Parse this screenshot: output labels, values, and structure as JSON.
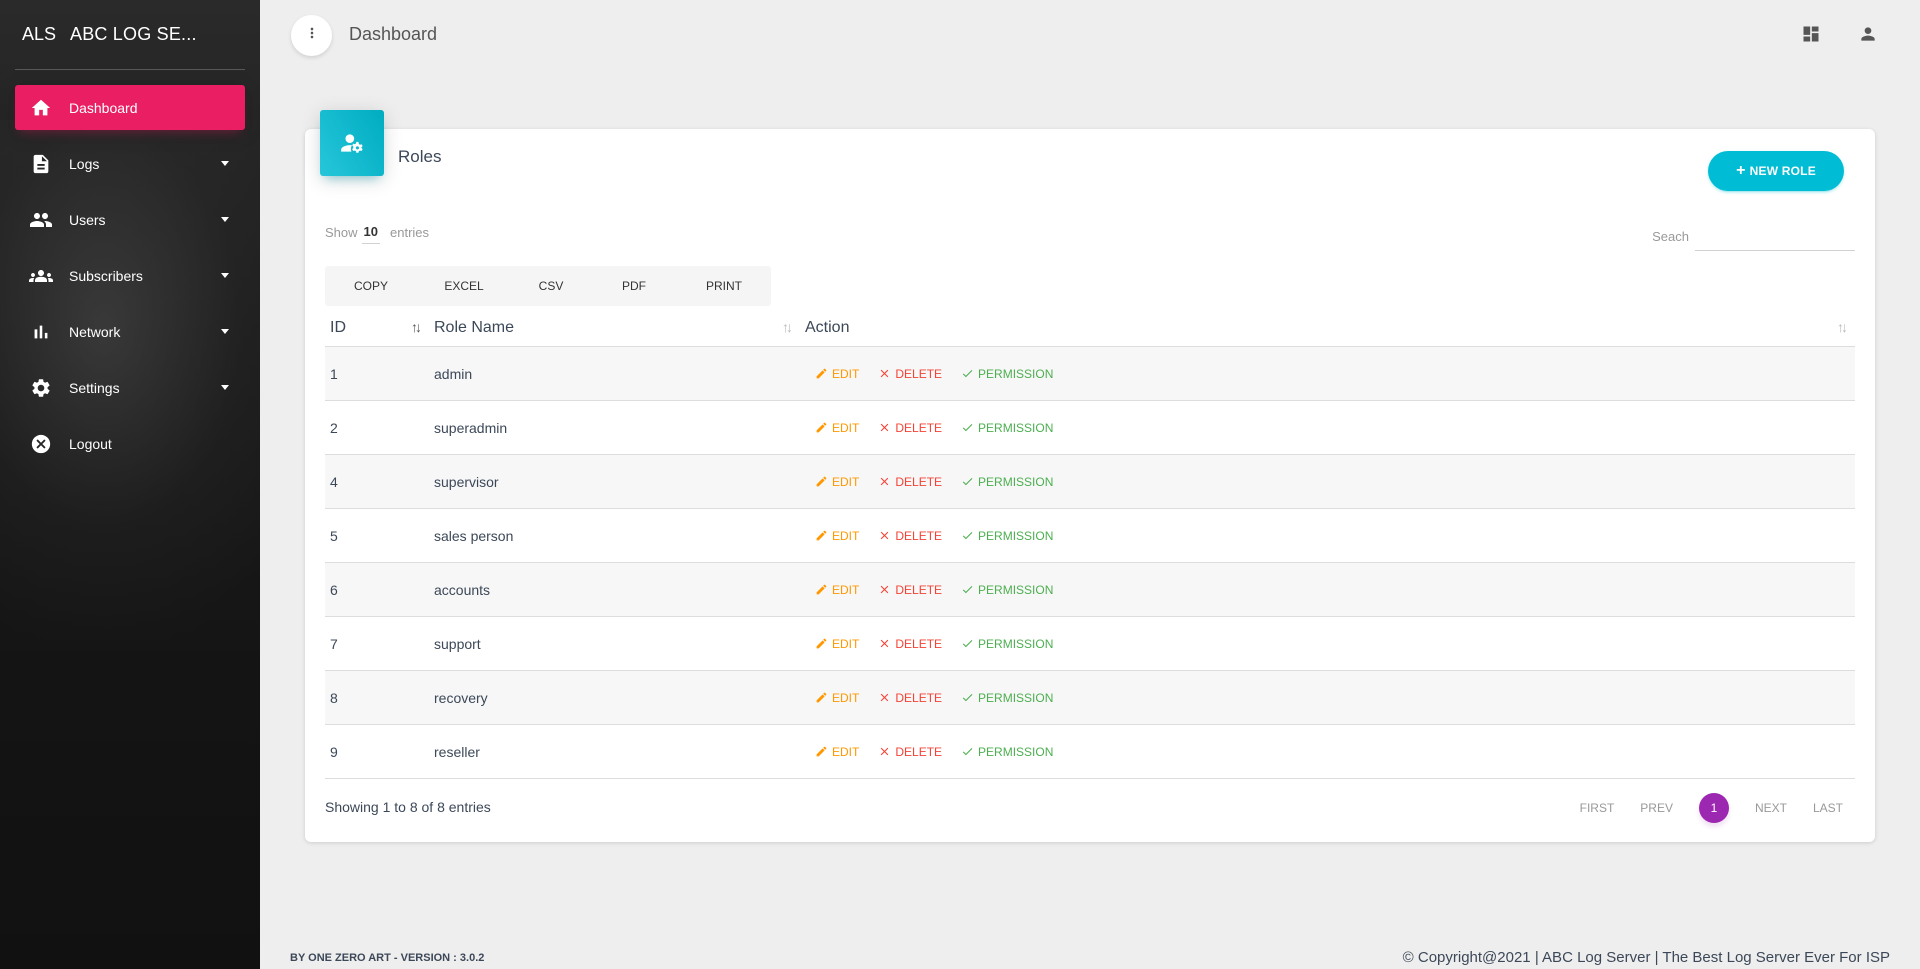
{
  "brand": {
    "mini": "ALS",
    "full": "ABC LOG SE..."
  },
  "sidebar": {
    "items": [
      {
        "label": "Dashboard",
        "icon": "home-icon",
        "active": true,
        "caret": false
      },
      {
        "label": "Logs",
        "icon": "document-icon",
        "active": false,
        "caret": true
      },
      {
        "label": "Users",
        "icon": "people-icon",
        "active": false,
        "caret": true
      },
      {
        "label": "Subscribers",
        "icon": "groups-icon",
        "active": false,
        "caret": true
      },
      {
        "label": "Network",
        "icon": "bar-chart-icon",
        "active": false,
        "caret": true
      },
      {
        "label": "Settings",
        "icon": "gear-icon",
        "active": false,
        "caret": true
      },
      {
        "label": "Logout",
        "icon": "cancel-circle-icon",
        "active": false,
        "caret": false
      }
    ]
  },
  "topbar": {
    "title": "Dashboard"
  },
  "card": {
    "title": "Roles",
    "new_button": "NEW ROLE",
    "length_prefix": "Show",
    "length_value": "10",
    "length_suffix": "entries",
    "search_label": "Seach",
    "search_value": "",
    "export_buttons": [
      "COPY",
      "EXCEL",
      "CSV",
      "PDF",
      "PRINT"
    ],
    "columns": [
      "ID",
      "Role Name",
      "Action"
    ],
    "actions": {
      "edit": "EDIT",
      "delete": "DELETE",
      "permission": "PERMISSION"
    },
    "rows": [
      {
        "id": "1",
        "name": "admin"
      },
      {
        "id": "2",
        "name": "superadmin"
      },
      {
        "id": "4",
        "name": "supervisor"
      },
      {
        "id": "5",
        "name": "sales person"
      },
      {
        "id": "6",
        "name": "accounts"
      },
      {
        "id": "7",
        "name": "support"
      },
      {
        "id": "8",
        "name": "recovery"
      },
      {
        "id": "9",
        "name": "reseller"
      }
    ],
    "info": "Showing 1 to 8 of 8 entries",
    "pagination": {
      "first": "FIRST",
      "prev": "PREV",
      "current": "1",
      "next": "NEXT",
      "last": "LAST"
    }
  },
  "footer": {
    "left": "BY ONE ZERO ART - VERSION : 3.0.2",
    "right": "© Copyright@2021 | ABC Log Server | The Best Log Server Ever For ISP"
  },
  "colors": {
    "active": "#e91e63",
    "info": "#00bcd4",
    "page": "#9c27b0",
    "edit": "#ff9800",
    "delete": "#f44336",
    "permission": "#4caf50"
  }
}
